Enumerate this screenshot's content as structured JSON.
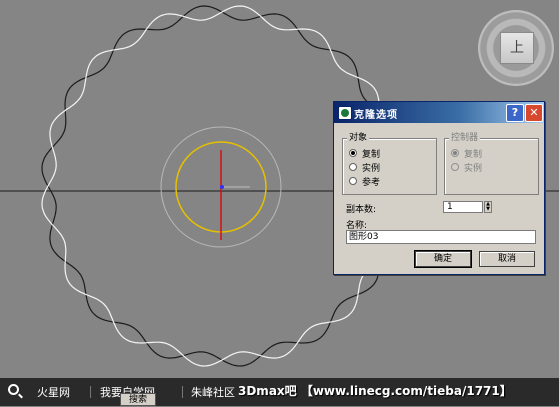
{
  "viewcube": {
    "face_label": "上"
  },
  "dialog": {
    "title": "克隆选项",
    "help_label": "?",
    "close_label": "✕",
    "object_group": {
      "legend": "对象",
      "options": [
        {
          "label": "复制",
          "selected": true
        },
        {
          "label": "实例",
          "selected": false
        },
        {
          "label": "参考",
          "selected": false
        }
      ]
    },
    "controller_group": {
      "legend": "控制器",
      "options": [
        {
          "label": "复制",
          "selected": true
        },
        {
          "label": "实例",
          "selected": false
        }
      ]
    },
    "copies_label": "副本数:",
    "copies_value": "1",
    "name_label": "名称:",
    "name_value": "图形03",
    "ok_label": "确定",
    "cancel_label": "取消"
  },
  "bottombar": {
    "items": [
      "火星网",
      "我要自学网",
      "朱峰社区"
    ],
    "watermark": "3Dmax吧 【www.linecg.com/tieba/1771】",
    "search_tab": "搜索"
  }
}
